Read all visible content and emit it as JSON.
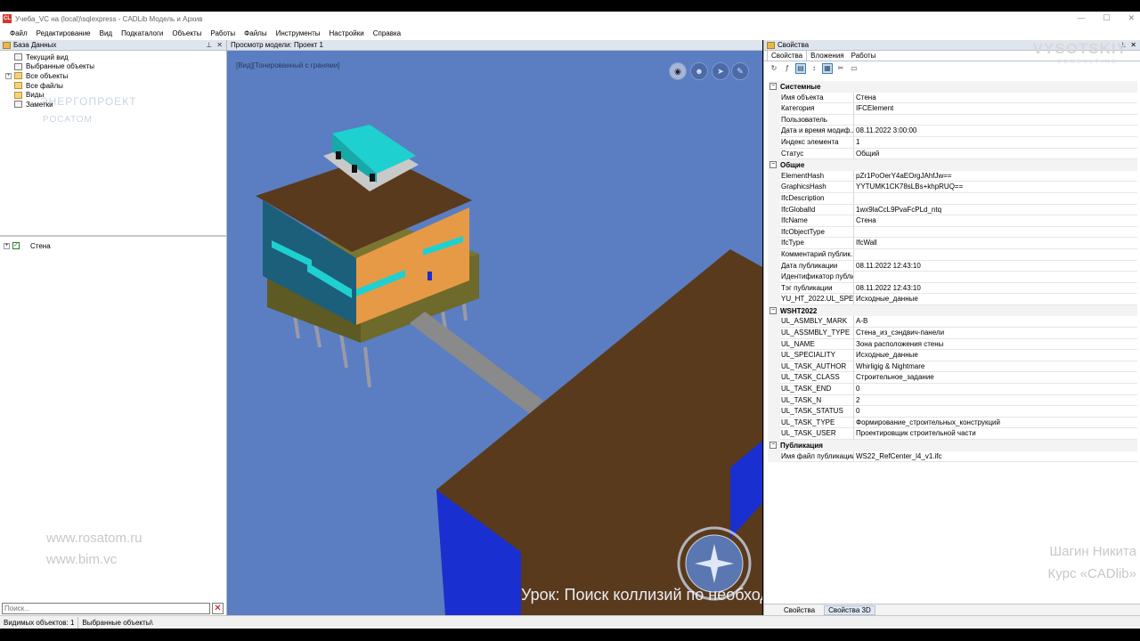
{
  "window": {
    "title": "Учеба_VC на (local)\\sqlexpress - CADLib Модель и Архив",
    "controls": [
      "—",
      "☐",
      "✕"
    ]
  },
  "menu": [
    "Файл",
    "Редактирование",
    "Вид",
    "Подкаталоги",
    "Объекты",
    "Работы",
    "Файлы",
    "Инструменты",
    "Настройки",
    "Справка"
  ],
  "left_panel": {
    "title": "База Данных",
    "tree": [
      {
        "label": "Текущий вид",
        "icon": "current-view-icon"
      },
      {
        "label": "Выбранные объекты",
        "icon": "selected-objects-icon"
      },
      {
        "label": "Все объекты",
        "icon": "folder-icon"
      },
      {
        "label": "Все файлы",
        "icon": "folder-icon"
      },
      {
        "label": "Виды",
        "icon": "folder-icon"
      },
      {
        "label": "Заметки",
        "icon": "notes-icon"
      }
    ],
    "layer": {
      "label": "Стена",
      "checked": true
    },
    "search_placeholder": "Поиск..."
  },
  "watermarks": {
    "org_line1": "ЭНЕРГОПРОЕКТ",
    "org_line2": "РОСАТОМ",
    "site1": "www.rosatom.ru",
    "site2": "www.bim.vc",
    "brand": "VYSOTSKIY",
    "brand_sub": "CONSULTING",
    "author": "Шагин Никита",
    "course": "Курс «CADlib»",
    "lesson": "Урок: Поиск коллизий по необходимым атрибутам модели. Принцип работы"
  },
  "viewport": {
    "title": "Просмотр модели: Проект 1",
    "mode_label": "[Вид][Тонированный с гранями]",
    "tools": [
      "eye-icon",
      "walk-icon",
      "fly-icon",
      "settings-icon"
    ],
    "colors": {
      "background": "#5b7ec2",
      "roof": "#5a3a1c",
      "wall": "#e79a45",
      "panel": "#1fd0d0",
      "base": "#6e6a2c",
      "bridge": "#8a8a8a",
      "blue_wall": "#1a2fd0"
    }
  },
  "right_panel": {
    "title": "Свойства",
    "tabs": [
      "Свойства",
      "Вложения",
      "Работы"
    ],
    "toolbar": [
      "refresh-icon",
      "filter-icon",
      "categorized-icon",
      "sort-icon",
      "props-icon",
      "link-icon",
      "options-icon"
    ],
    "sections": [
      {
        "name": "Системные",
        "rows": [
          [
            "Имя объекта",
            "Стена"
          ],
          [
            "Категория",
            "IFCElement"
          ],
          [
            "Пользователь",
            ""
          ],
          [
            "Дата и время модиф...",
            "08.11.2022 3:00:00"
          ],
          [
            "Индекс элемента",
            "1"
          ],
          [
            "Статус",
            "Общий"
          ]
        ]
      },
      {
        "name": "Общие",
        "rows": [
          [
            "ElementHash",
            "pZr1PoOerY4aEOrgJAhfJw=="
          ],
          [
            "GraphicsHash",
            "YYTUMK1CK78sLBs+khpRUQ=="
          ],
          [
            "IfcDescription",
            ""
          ],
          [
            "IfcGlobalId",
            "1wx9laCcL9PvaFcPLd_ntq"
          ],
          [
            "IfcName",
            "Стена"
          ],
          [
            "IfcObjectType",
            ""
          ],
          [
            "IfcType",
            "IfcWall"
          ],
          [
            "Комментарий публик...",
            ""
          ],
          [
            "Дата публикации",
            "08.11.2022 12:43:10"
          ],
          [
            "Идентификатор публи...",
            ""
          ],
          [
            "Тэг публикации",
            "08.11.2022 12:43:10"
          ],
          [
            "YU_HT_2022.UL_SPE...",
            "Исходные_данные"
          ]
        ]
      },
      {
        "name": "WSHT2022",
        "rows": [
          [
            "UL_ASMBLY_MARK",
            "А-В"
          ],
          [
            "UL_ASSMBLY_TYPE",
            "Стена_из_сэндвич-панели"
          ],
          [
            "UL_NAME",
            "Зона расположения стены"
          ],
          [
            "UL_SPECIALITY",
            "Исходные_данные"
          ],
          [
            "UL_TASK_AUTHOR",
            "Whirligig & Nightmare"
          ],
          [
            "UL_TASK_CLASS",
            "Строительное_задание"
          ],
          [
            "UL_TASK_END",
            "0"
          ],
          [
            "UL_TASK_N",
            "2"
          ],
          [
            "UL_TASK_STATUS",
            "0"
          ],
          [
            "UL_TASK_TYPE",
            "Формирование_строительных_конструкций"
          ],
          [
            "UL_TASK_USER",
            "Проектировщик строительной части"
          ]
        ]
      },
      {
        "name": "Публикация",
        "rows": [
          [
            "Имя файл публикации",
            "WS22_RefCenter_l4_v1.ifc"
          ]
        ]
      }
    ],
    "bottom_tabs": [
      "Свойства",
      "Свойства 3D"
    ]
  },
  "status": {
    "visible_objects": "Видимых объектов: 1",
    "path": "Выбранные объекты\\"
  }
}
